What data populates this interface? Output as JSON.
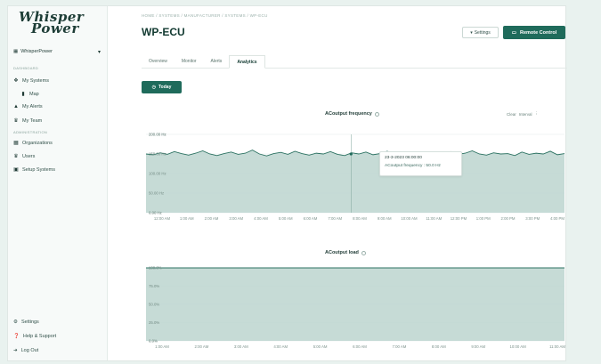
{
  "brand": {
    "line1": "Whisper",
    "line2": "Power"
  },
  "org_select": {
    "value": "WhisperPower"
  },
  "sidebar": {
    "sections": {
      "dashboard": "DASHBOARD",
      "administration": "ADMINISTRATION"
    },
    "items": [
      {
        "label": "My Systems",
        "icon": "systems-icon"
      },
      {
        "label": "Map",
        "icon": "map-icon"
      },
      {
        "label": "My Alerts",
        "icon": "alert-icon"
      },
      {
        "label": "My Team",
        "icon": "team-icon"
      },
      {
        "label": "Organizations",
        "icon": "building-icon"
      },
      {
        "label": "Users",
        "icon": "users-icon"
      },
      {
        "label": "Setup Systems",
        "icon": "setup-icon"
      }
    ],
    "bottom": [
      {
        "label": "Settings",
        "icon": "gear-icon"
      },
      {
        "label": "Help & Support",
        "icon": "help-icon"
      },
      {
        "label": "Log Out",
        "icon": "logout-icon"
      }
    ]
  },
  "header": {
    "breadcrumb": "HOME / SYSTEMS / MANUFACTURER / SYSTEMS / WP-ECU",
    "title": "WP-ECU",
    "settings_label": "Settings",
    "remote_label": "Remote Control"
  },
  "tabs": [
    {
      "label": "Overview",
      "active": false
    },
    {
      "label": "Monitor",
      "active": false
    },
    {
      "label": "Alerts",
      "active": false
    },
    {
      "label": "Analytics",
      "active": true
    }
  ],
  "today_label": "Today",
  "tools": {
    "clear": "Clear",
    "interval": "Interval"
  },
  "tooltip": {
    "date": "23-3-2023 06:00:00",
    "value": "ACoutput frequency : 50.0 Hz"
  },
  "colors": {
    "accent": "#1f6b5b",
    "area_fill": "#bcd5cf",
    "area_stroke": "#2c7262",
    "background": "#e9f2ef"
  },
  "chart_data": [
    {
      "type": "area",
      "title": "ACoutput frequency",
      "yticks": [
        "200.00 Hz",
        "150.00 Hz",
        "100.00 Hz",
        "50.00 Hz",
        "0.00 Hz"
      ],
      "ylim": [
        0,
        200
      ],
      "xticks": [
        "12:00 AM",
        "1:00 AM",
        "2:00 AM",
        "3:00 AM",
        "4:00 AM",
        "5:00 AM",
        "6:00 AM",
        "7:00 AM",
        "8:00 AM",
        "9:00 AM",
        "10:00 AM",
        "11:00 AM",
        "12:00 PM",
        "1:00 PM",
        "2:00 PM",
        "3:00 PM",
        "4:00 PM"
      ],
      "series": [
        {
          "values": [
            150,
            148,
            153,
            149,
            156,
            151,
            147,
            152,
            158,
            150,
            146,
            151,
            155,
            149,
            152,
            160,
            150,
            145,
            151,
            154,
            149,
            157,
            151,
            147,
            152,
            150,
            156,
            149,
            146,
            153,
            150,
            155,
            148,
            151,
            157,
            150,
            147,
            152,
            149,
            154,
            151,
            145,
            150,
            156,
            149,
            152,
            158,
            150,
            147,
            153,
            150,
            151,
            146,
            155,
            149,
            152,
            150,
            157,
            148,
            151
          ]
        }
      ],
      "grid": true
    },
    {
      "type": "area",
      "title": "ACoutput load",
      "yticks": [
        "100.0%",
        "75.0%",
        "50.0%",
        "25.0%",
        "0.0%"
      ],
      "ylim": [
        0,
        100
      ],
      "xticks": [
        "1:00 AM",
        "2:00 AM",
        "3:00 AM",
        "4:00 AM",
        "5:00 AM",
        "6:00 AM",
        "7:00 AM",
        "8:00 AM",
        "9:00 AM",
        "10:00 AM",
        "11:00 AM"
      ],
      "series": [
        {
          "values": [
            100,
            100
          ]
        }
      ],
      "grid": true
    }
  ]
}
